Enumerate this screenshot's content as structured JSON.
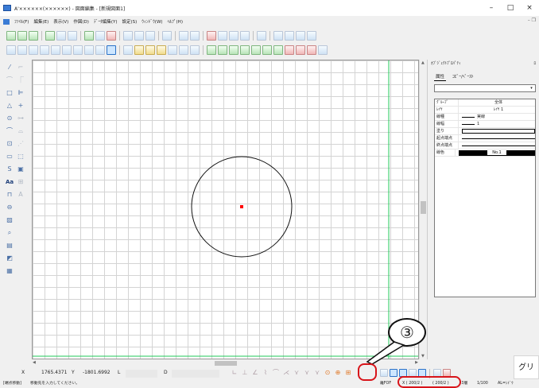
{
  "window": {
    "title": "A'××××××(××××××) - 図面編集 - [新規図面1]"
  },
  "winbtns": {
    "min": "–",
    "max": "□",
    "close": "×"
  },
  "mdi": {
    "controls": "– ❐"
  },
  "menu": [
    "ﾌｧｲﾙ(F)",
    "編集(E)",
    "表示(V)",
    "作図(D)",
    "ﾃﾞｰﾀ編集(Y)",
    "設定(S)",
    "ｳｨﾝﾄﾞｳ(W)",
    "ﾍﾙﾌﾟ(H)"
  ],
  "left_tools": {
    "text_tool": "Aa"
  },
  "property_panel": {
    "title": "ｵﾌﾞｼﾞｪｸﾄﾌﾟﾛﾊﾟﾃｨ",
    "pin": "ﾛ",
    "tabs": [
      "属性",
      "ｺﾋﾟｰ/ﾍﾟｰｽﾄ"
    ],
    "dropdown_arrow": "▾",
    "rows": [
      {
        "key": "ｸﾞﾙｰﾌﾟ",
        "value": "全体"
      },
      {
        "key": "ﾚｲﾔ",
        "value": "ﾚｲﾔ 1"
      },
      {
        "key": "線種",
        "value": "実線"
      },
      {
        "key": "線幅",
        "value": "1"
      },
      {
        "key": "塗り",
        "value": ""
      },
      {
        "key": "起点端点",
        "value": ""
      },
      {
        "key": "終点端点",
        "value": ""
      },
      {
        "key": "線色",
        "value": "No.1"
      }
    ]
  },
  "status": {
    "x_label": "X",
    "x_value": "1765.4371",
    "y_label": "Y",
    "y_value": "-1801.6992",
    "l_label": "L",
    "d_label": "D"
  },
  "bottom": {
    "mode": "[端点移動]",
    "hint": "移動先を入力してください。",
    "snap": "離FOF",
    "grid1": "X ( 200/2 )",
    "grid2": "( 200/2 )",
    "layer": "ﾚ3層",
    "scale": "1/100",
    "extra": "AL=ｼﾄﾞｳ"
  },
  "hint_box": {
    "text": "グリ"
  },
  "callout": {
    "number": "③"
  },
  "colors": {
    "accent_green": "#21c95a",
    "selection_red": "#d8141a",
    "center_point": "#ff0000"
  }
}
